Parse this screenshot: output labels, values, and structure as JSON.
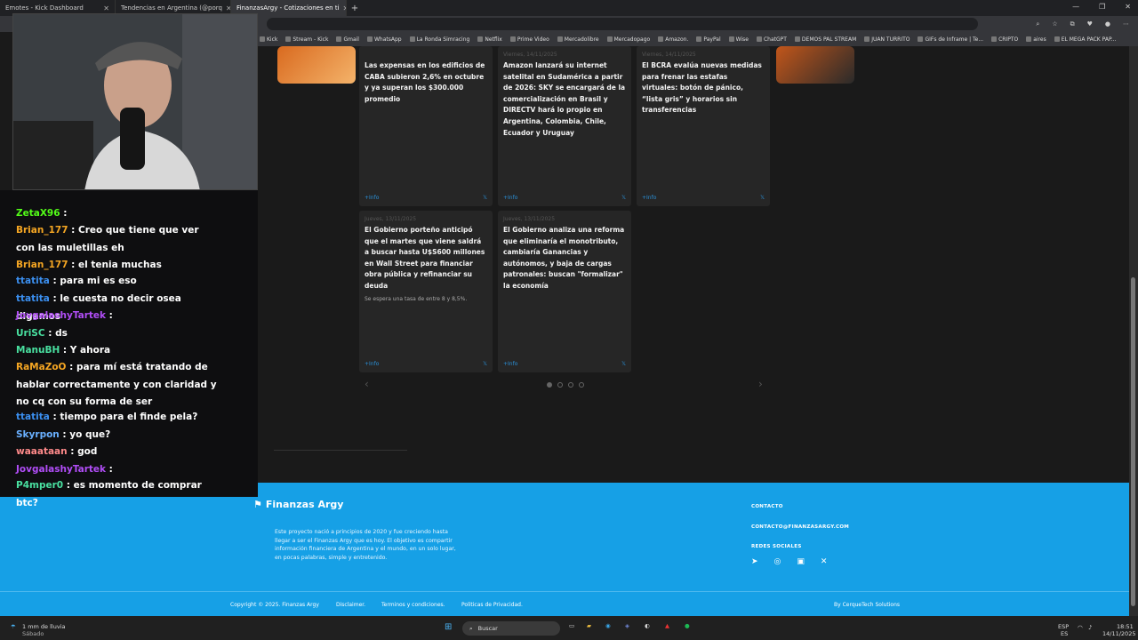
{
  "tabs": [
    {
      "label": "Emotes - Kick Dashboard",
      "active": false
    },
    {
      "label": "Tendencias en Argentina (@porq",
      "active": false
    },
    {
      "label": "FinanzasArgy - Cotizaciones en ti",
      "active": true
    }
  ],
  "bookmarks": [
    "Kick",
    "Stream - Kick",
    "Gmail",
    "WhatsApp",
    "La Ronda Simracing",
    "Netflix",
    "Prime Video",
    "Mercadolibre",
    "Mercadopago",
    "Amazon.",
    "PayPal",
    "Wise",
    "ChatGPT",
    "DEMOS PAL STREAM",
    "JUAN TURRITO",
    "GIFs de Inframe | Te...",
    "CRIPTO",
    "aires",
    "EL MEGA PACK PAP..."
  ],
  "news": {
    "cards_row1": [
      {
        "date": "",
        "title": "Las expensas en los edificios de CABA subieron 2,6% en octubre y ya superan los $300.000 promedio",
        "more": "+Info"
      },
      {
        "date": "Viernes, 14/11/2025",
        "title": "Amazon lanzará su internet satelital en Sudamérica a partir de 2026: SKY se encargará de la comercialización en Brasil y DIRECTV hará lo propio en Argentina, Colombia, Chile, Ecuador y Uruguay",
        "more": "+Info"
      },
      {
        "date": "Viernes, 14/11/2025",
        "title": "El BCRA evalúa nuevas medidas para frenar las estafas virtuales: botón de pánico, “lista gris” y horarios sin transferencias",
        "more": "+Info"
      }
    ],
    "cards_row2": [
      {
        "date": "Jueves, 13/11/2025",
        "title": "El Gobierno porteño anticipó que el martes que viene saldrá a buscar hasta U$S600 millones en Wall Street para financiar obra pública y refinanciar su deuda",
        "subtitle": "Se espera una tasa de entre 8 y 8,5%.",
        "more": "+Info"
      },
      {
        "date": "Jueves, 13/11/2025",
        "title": "El Gobierno analiza una reforma que eliminaría el monotributo, cambiaría Ganancias y autónomos, y baja de cargas patronales: buscan \"formalizar\" la economía",
        "subtitle": "",
        "more": "+Info"
      }
    ]
  },
  "footer": {
    "brand": "Finanzas Argy",
    "description": "Este proyecto nació a principios de 2020 y fue creciendo hasta llegar a ser el Finanzas Argy que es hoy. El objetivo es compartir información financiera de Argentina y el mundo, en un solo lugar, en pocas palabras, simple y entretenido.",
    "contact_heading": "CONTACTO",
    "contact_email": "CONTACTO@FINANZASARGY.COM",
    "social_heading": "REDES SOCIALES",
    "copyright": "Copyright © 2025. Finanzas Argy",
    "links": [
      "Disclaimer.",
      "Terminos y condiciones.",
      "Politicas de Privacidad."
    ],
    "credit": "By CerqueTech Solutions"
  },
  "chat": [
    {
      "user": "ZetaX96",
      "color": "#53fc18",
      "text": ""
    },
    {
      "user": "Brian_177",
      "color": "#f5a623",
      "text": "Creo que tiene que ver con las muletillas eh"
    },
    {
      "user": "Brian_177",
      "color": "#f5a623",
      "text": "el tenia muchas"
    },
    {
      "user": "ttatita",
      "color": "#3b8ff0",
      "text": "para mi es eso"
    },
    {
      "user": "ttatita",
      "color": "#3b8ff0",
      "text": "le cuesta no decir osea digamos"
    },
    {
      "user": "JovgalashyTartek",
      "color": "#b14df7",
      "text": ""
    },
    {
      "user": "UriSC",
      "color": "#49e0a0",
      "text": "ds"
    },
    {
      "user": "ManuBH",
      "color": "#49e0a0",
      "text": "Y ahora"
    },
    {
      "user": "RaMaZoO",
      "color": "#f5a623",
      "text": "para mí está tratando de hablar correctamente y con claridad y no cq con su forma de ser"
    },
    {
      "user": "ttatita",
      "color": "#3b8ff0",
      "text": "tiempo para el finde pela?"
    },
    {
      "user": "Skyrpon",
      "color": "#6ab0ff",
      "text": "yo que?"
    },
    {
      "user": "waaataan",
      "color": "#ff8a8a",
      "text": "god"
    },
    {
      "user": "JovgalashyTartek",
      "color": "#b14df7",
      "text": ""
    },
    {
      "user": "P4mper0",
      "color": "#49e0a0",
      "text": "es momento de comprar btc?"
    }
  ],
  "taskbar": {
    "weather": "1 mm de lluvia",
    "weather_sub": "Sábado",
    "search": "Buscar",
    "lang": "ESP",
    "lang_sub": "ES",
    "time": "18:51",
    "date": "14/11/2025"
  }
}
